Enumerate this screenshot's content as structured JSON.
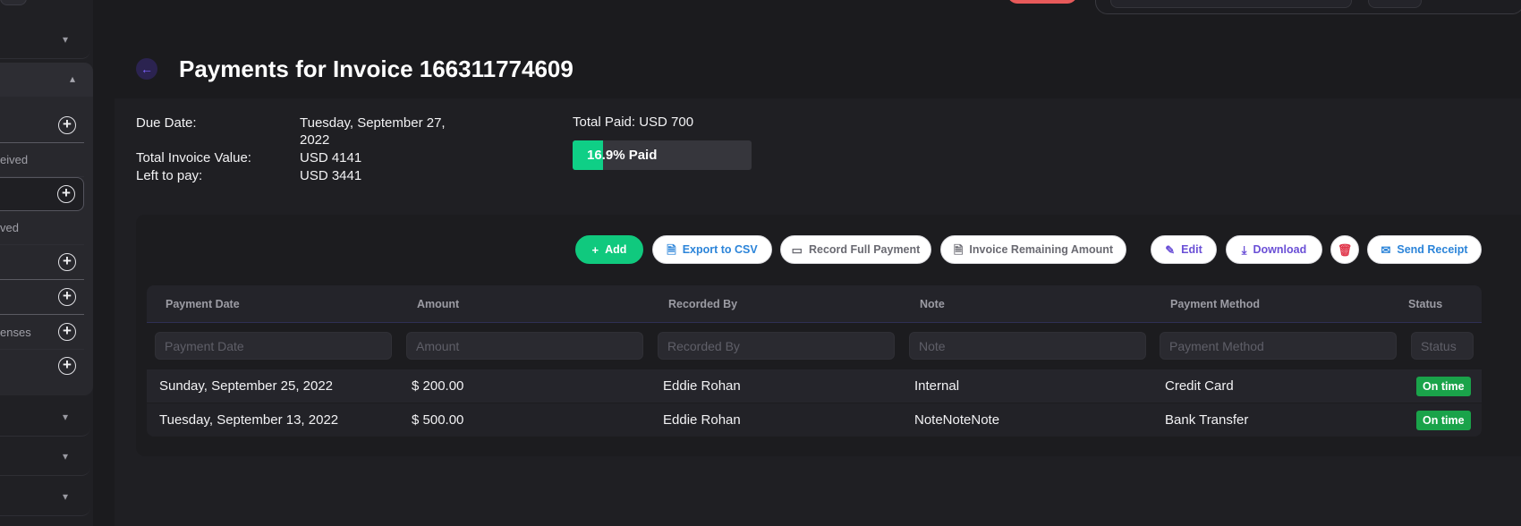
{
  "sidebar": {
    "items": [
      {
        "label": "eived"
      },
      {
        "label": ""
      },
      {
        "label": "ved"
      },
      {
        "label": ""
      },
      {
        "label": ""
      },
      {
        "label": "enses"
      },
      {
        "label": ""
      }
    ]
  },
  "page": {
    "title": "Payments for Invoice 166311774609"
  },
  "summary": {
    "due_date_label": "Due Date:",
    "due_date_line1": "Tuesday, September 27,",
    "due_date_line2": "2022",
    "total_value_label": "Total Invoice Value:",
    "total_value": "USD 4141",
    "left_label": "Left to pay:",
    "left_value": "USD 3441",
    "total_paid": "Total Paid: USD 700",
    "progress_text": "16.9% Paid",
    "progress_fraction": 0.169
  },
  "toolbar": {
    "add": "Add",
    "export": "Export to CSV",
    "record_full": "Record Full Payment",
    "invoice_remaining": "Invoice Remaining Amount",
    "edit": "Edit",
    "download": "Download",
    "send_receipt": "Send Receipt"
  },
  "table": {
    "columns": [
      "Payment Date",
      "Amount",
      "Recorded By",
      "Note",
      "Payment Method",
      "Status"
    ],
    "filters": [
      "Payment Date",
      "Amount",
      "Recorded By",
      "Note",
      "Payment Method",
      "Status"
    ],
    "rows": [
      {
        "date": "Sunday, September 25, 2022",
        "amount": "$ 200.00",
        "recorded_by": "Eddie Rohan",
        "note": "Internal",
        "method": "Credit Card",
        "status": "On time"
      },
      {
        "date": "Tuesday, September 13, 2022",
        "amount": "$ 500.00",
        "recorded_by": "Eddie Rohan",
        "note": "NoteNoteNote",
        "method": "Bank Transfer",
        "status": "On time"
      }
    ]
  },
  "colors": {
    "accent_green": "#10c97e",
    "status_green": "#1aa34a",
    "link_blue": "#2b84d9",
    "purple": "#6a4fd6",
    "danger": "#e0354a"
  }
}
